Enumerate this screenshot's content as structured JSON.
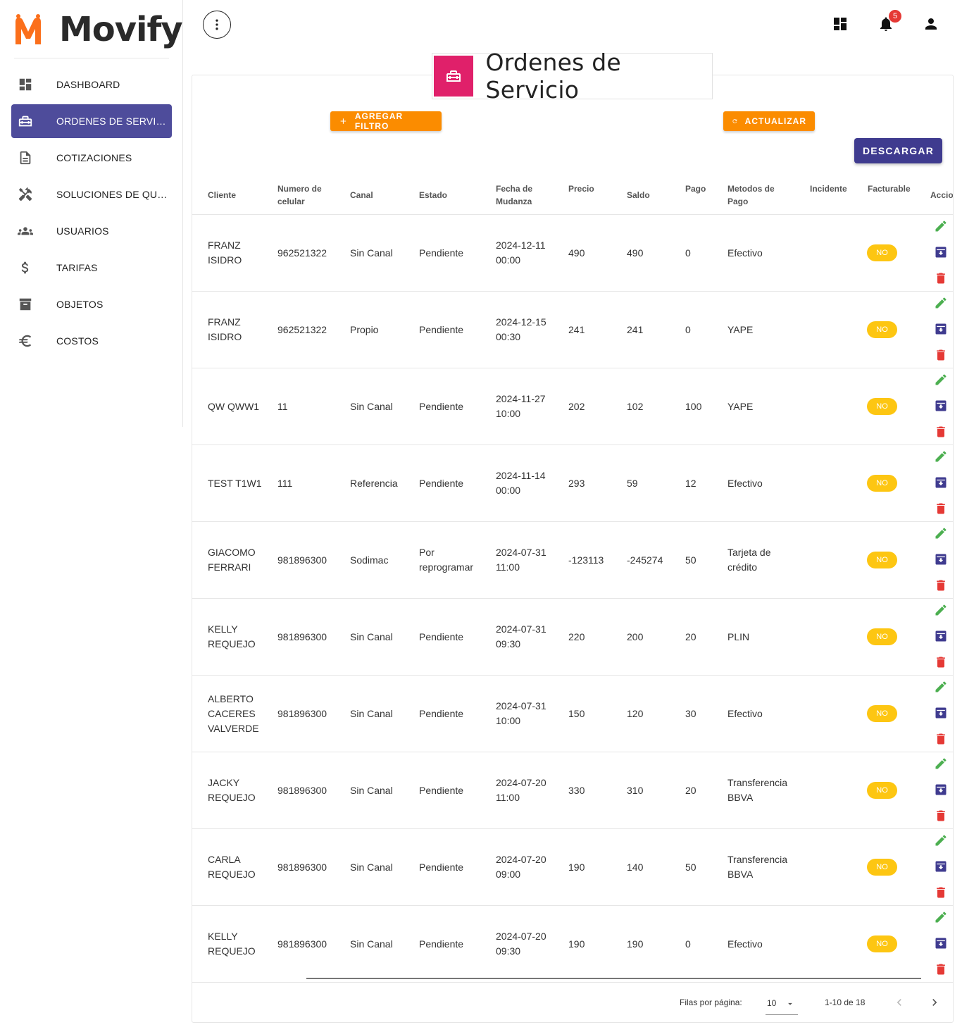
{
  "brand": {
    "name": "Movify",
    "logo": "movify-m-logo",
    "accent": "#fb6f1b"
  },
  "sidebar": {
    "active_color": "#4e4c9b",
    "items": [
      {
        "label": "DASHBOARD",
        "icon": "dashboard-icon"
      },
      {
        "label": "ORDENES DE SERVICIO",
        "icon": "toolbox-icon",
        "active": true
      },
      {
        "label": "COTIZACIONES",
        "icon": "document-icon"
      },
      {
        "label": "SOLUCIONES DE QUIEBRE",
        "icon": "tools-icon"
      },
      {
        "label": "USUARIOS",
        "icon": "people-icon"
      },
      {
        "label": "TARIFAS",
        "icon": "dollar-icon"
      },
      {
        "label": "OBJETOS",
        "icon": "archive-icon"
      },
      {
        "label": "COSTOS",
        "icon": "euro-icon"
      }
    ]
  },
  "topbar": {
    "notifications_count": "5",
    "icons": [
      "more-vertical-icon",
      "dashboard-icon",
      "bell-icon",
      "person-icon"
    ]
  },
  "page": {
    "title": "Ordenes de Servicio",
    "title_icon": "toolbox-icon",
    "title_icon_color": "#e0206a",
    "add_filter_label": "AGREGAR FILTRO",
    "refresh_label": "ACTUALIZAR",
    "download_label": "DESCARGAR"
  },
  "table": {
    "headers": {
      "cliente": "Cliente",
      "celular": "Numero de celular",
      "canal": "Canal",
      "estado": "Estado",
      "fecha": "Fecha de Mudanza",
      "precio": "Precio",
      "saldo": "Saldo",
      "pago": "Pago",
      "metodos": "Metodos de Pago",
      "incidente": "Incidente",
      "facturable": "Facturable",
      "acciones": "Acciones"
    },
    "rows": [
      {
        "cliente": "FRANZ ISIDRO",
        "celular": "962521322",
        "canal": "Sin Canal",
        "estado": "Pendiente",
        "fecha": "2024-12-11 00:00",
        "precio": "490",
        "saldo": "490",
        "pago": "0",
        "metodo": "Efectivo",
        "incidente": "",
        "facturable": "NO"
      },
      {
        "cliente": "FRANZ ISIDRO",
        "celular": "962521322",
        "canal": "Propio",
        "estado": "Pendiente",
        "fecha": "2024-12-15 00:30",
        "precio": "241",
        "saldo": "241",
        "pago": "0",
        "metodo": "YAPE",
        "incidente": "",
        "facturable": "NO"
      },
      {
        "cliente": "QW QWW1",
        "celular": "11",
        "canal": "Sin Canal",
        "estado": "Pendiente",
        "fecha": "2024-11-27 10:00",
        "precio": "202",
        "saldo": "102",
        "pago": "100",
        "metodo": "YAPE",
        "incidente": "",
        "facturable": "NO"
      },
      {
        "cliente": "TEST T1W1",
        "celular": "111",
        "canal": "Referencia",
        "estado": "Pendiente",
        "fecha": "2024-11-14 00:00",
        "precio": "293",
        "saldo": "59",
        "pago": "12",
        "metodo": "Efectivo",
        "incidente": "",
        "facturable": "NO"
      },
      {
        "cliente": "GIACOMO FERRARI",
        "celular": "981896300",
        "canal": "Sodimac",
        "estado": "Por reprogramar",
        "fecha": "2024-07-31 11:00",
        "precio": "-123113",
        "saldo": "-245274",
        "pago": "50",
        "metodo": "Tarjeta de crédito",
        "incidente": "",
        "facturable": "NO"
      },
      {
        "cliente": "KELLY REQUEJO",
        "celular": "981896300",
        "canal": "Sin Canal",
        "estado": "Pendiente",
        "fecha": "2024-07-31 09:30",
        "precio": "220",
        "saldo": "200",
        "pago": "20",
        "metodo": "PLIN",
        "incidente": "",
        "facturable": "NO"
      },
      {
        "cliente": "ALBERTO CACERES VALVERDE",
        "celular": "981896300",
        "canal": "Sin Canal",
        "estado": "Pendiente",
        "fecha": "2024-07-31 10:00",
        "precio": "150",
        "saldo": "120",
        "pago": "30",
        "metodo": "Efectivo",
        "incidente": "",
        "facturable": "NO"
      },
      {
        "cliente": "JACKY REQUEJO",
        "celular": "981896300",
        "canal": "Sin Canal",
        "estado": "Pendiente",
        "fecha": "2024-07-20 11:00",
        "precio": "330",
        "saldo": "310",
        "pago": "20",
        "metodo": "Transferencia BBVA",
        "incidente": "",
        "facturable": "NO"
      },
      {
        "cliente": "CARLA REQUEJO",
        "celular": "981896300",
        "canal": "Sin Canal",
        "estado": "Pendiente",
        "fecha": "2024-07-20 09:00",
        "precio": "190",
        "saldo": "140",
        "pago": "50",
        "metodo": "Transferencia BBVA",
        "incidente": "",
        "facturable": "NO"
      },
      {
        "cliente": "KELLY REQUEJO",
        "celular": "981896300",
        "canal": "Sin Canal",
        "estado": "Pendiente",
        "fecha": "2024-07-20 09:30",
        "precio": "190",
        "saldo": "190",
        "pago": "0",
        "metodo": "Efectivo",
        "incidente": "",
        "facturable": "NO"
      }
    ],
    "row_actions": [
      "edit-icon",
      "archive-download-icon",
      "delete-icon"
    ]
  },
  "pagination": {
    "rows_per_page_label": "Filas por página:",
    "rows_per_page": "10",
    "range": "1-10 de 18"
  },
  "colors": {
    "orange": "#fb8c00",
    "purple": "#3f3b8f",
    "chip_yellow": "#fdc612",
    "edit_green": "#4caf50",
    "delete_red": "#e53935"
  }
}
